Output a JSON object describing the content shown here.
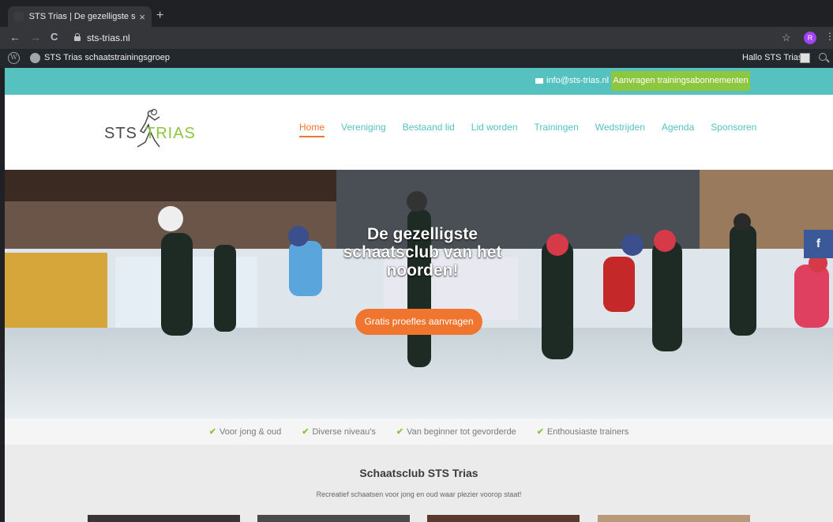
{
  "browser": {
    "tab_title": "STS Trias | De gezelligste scha",
    "close_glyph": "×",
    "new_tab_glyph": "+",
    "back_glyph": "←",
    "forward_glyph": "→",
    "reload_glyph": "C",
    "url": "sts-trias.nl",
    "star_glyph": "☆",
    "profile_initial": "R",
    "menu_glyph": "⋮"
  },
  "wp_admin_bar": {
    "logo_glyph": "W",
    "site_name": "STS Trias schaatstrainingsgroep",
    "greeting": "Hallo STS Trias"
  },
  "topbar": {
    "email": "info@sts-trias.nl",
    "cta": "Aanvragen trainingsabonnementen"
  },
  "logo": {
    "part1": "STS",
    "part2": "TRIAS"
  },
  "nav": {
    "items": [
      "Home",
      "Vereniging",
      "Bestaand lid",
      "Lid worden",
      "Trainingen",
      "Wedstrijden",
      "Agenda",
      "Sponsoren"
    ],
    "active": "Home"
  },
  "hero": {
    "title": "De gezelligste schaatsclub van het noorden!",
    "button": "Gratis proefles aanvragen",
    "facebook": "f"
  },
  "usps": [
    "Voor jong & oud",
    "Diverse niveau's",
    "Van beginner tot gevorderde",
    "Enthousiaste trainers"
  ],
  "intro": {
    "heading": "Schaatsclub STS Trias",
    "text": "Recreatief schaatsen voor jong en oud waar plezier voorop staat!"
  },
  "colors": {
    "teal": "#56c2c0",
    "green": "#8dc63f",
    "orange": "#f0752e",
    "facebook": "#3b5998"
  }
}
